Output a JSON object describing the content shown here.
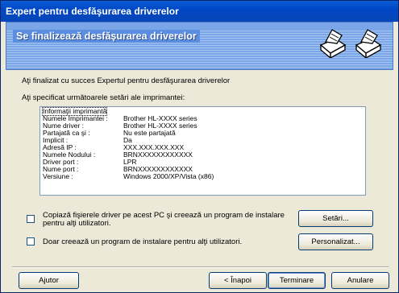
{
  "window": {
    "title": "Expert pentru desfăşurarea driverelor"
  },
  "header": {
    "title": "Se finalizează desfăşurarea driverelor"
  },
  "intro": "Aţi finalizat cu succes Expertul pentru desfăşurarea driverelor",
  "settings_label": "Aţi specificat următoarele setări ale imprimantei:",
  "list": [
    {
      "k": "Informaţii imprimantă",
      "v": ""
    },
    {
      "k": "Numele Imprimantei :",
      "v": "Brother HL-XXXX  series"
    },
    {
      "k": "Nume driver :",
      "v": "Brother HL-XXXX  series"
    },
    {
      "k": "Partajată ca şi :",
      "v": "Nu este partajată"
    },
    {
      "k": "Implicit :",
      "v": "Da"
    },
    {
      "k": "Adresă IP :",
      "v": "XXX.XXX.XXX.XXX"
    },
    {
      "k": "Numele Nodului :",
      "v": "BRNXXXXXXXXXXXX"
    },
    {
      "k": "Driver port :",
      "v": "LPR"
    },
    {
      "k": "Nume port :",
      "v": "BRNXXXXXXXXXXXX"
    },
    {
      "k": "Versiune :",
      "v": "Windows 2000/XP/Vista (x86)"
    }
  ],
  "options": {
    "copy_label_line1": "Copiază fişierele driver pe acest PC şi creează un program de instalare",
    "copy_label_line2": "pentru alţi utilizatori.",
    "only_label": "Doar creează un program de instalare pentru alţi utilizatori.",
    "settings_button": "Setări...",
    "customize_button": "Personalizat..."
  },
  "footer": {
    "help": "Ajutor",
    "back": "< Înapoi",
    "finish": "Terminare",
    "cancel": "Anulare"
  },
  "colors": {
    "titlebar": "#0a5ed8",
    "header": "#7aa6e8",
    "face": "#ece9d8"
  }
}
